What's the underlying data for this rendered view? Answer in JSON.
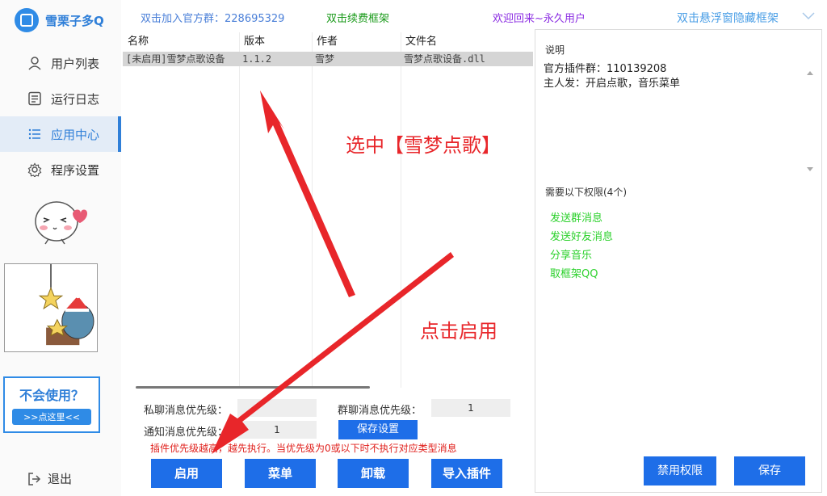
{
  "app": {
    "name": "雪栗子多Q"
  },
  "sidebar": {
    "items": [
      {
        "label": "用户列表",
        "icon": "user-icon",
        "active": false
      },
      {
        "label": "运行日志",
        "icon": "log-icon",
        "active": false
      },
      {
        "label": "应用中心",
        "icon": "list-icon",
        "active": true
      },
      {
        "label": "程序设置",
        "icon": "gear-icon",
        "active": false
      }
    ],
    "help_title": "不会使用？",
    "help_link": ">>点这里<<",
    "logout": "退出"
  },
  "topbar": {
    "join_label": "双击加入官方群：",
    "join_number": "228695329",
    "renew": "双击续费框架",
    "welcome": "欢迎回来~永久用户",
    "hide": "双击悬浮窗隐藏框架"
  },
  "table": {
    "columns": [
      "名称",
      "版本",
      "作者",
      "文件名"
    ],
    "rows": [
      {
        "name": "[未启用]雪梦点歌设备",
        "version": "1.1.2",
        "author": "雪梦",
        "file": "雪梦点歌设备.dll"
      }
    ]
  },
  "priority": {
    "private_label": "私聊消息优先级：",
    "private_value": "",
    "group_label": "群聊消息优先级：",
    "group_value": "1",
    "notify_label": "通知消息优先级：",
    "notify_value": "1",
    "save_label": "保存设置",
    "warning": "插件优先级越高，越先执行。当优先级为0或以下时不执行对应类型消息"
  },
  "actions": {
    "enable": "启用",
    "menu": "菜单",
    "uninstall": "卸载",
    "import": "导入插件"
  },
  "panel": {
    "desc_title": "说明",
    "desc_lines": [
      "官方插件群：110139208",
      "主人发：开启点歌，音乐菜单"
    ],
    "perm_title": "需要以下权限(4个)",
    "permissions": [
      "发送群消息",
      "发送好友消息",
      "分享音乐",
      "取框架QQ"
    ],
    "disable_label": "禁用权限",
    "save_label": "保存"
  },
  "annotations": {
    "select": "选中【雪梦点歌】",
    "click": "点击启用"
  },
  "colors": {
    "accent": "#1e6ee8",
    "annotation": "#e8262a",
    "permission": "#2cd12c"
  }
}
